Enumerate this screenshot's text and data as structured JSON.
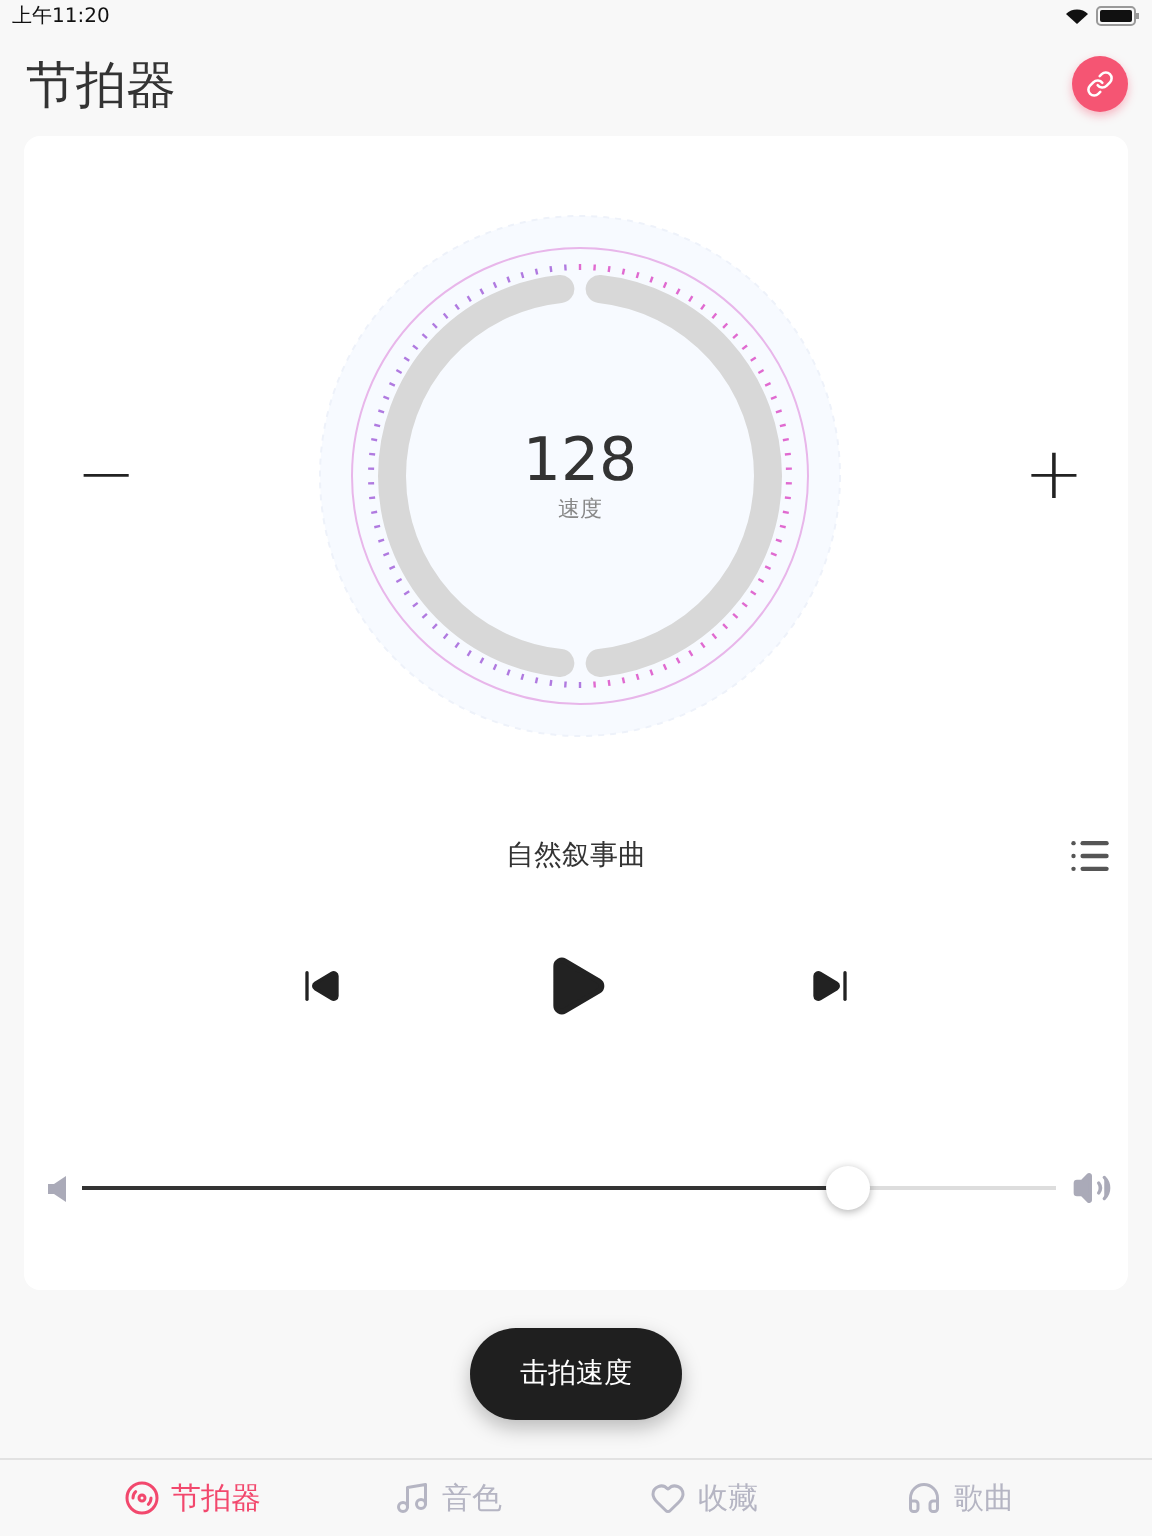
{
  "status_bar": {
    "time": "上午11:20"
  },
  "header": {
    "title": "节拍器"
  },
  "tempo": {
    "value": "128",
    "label": "速度",
    "decrease": "−",
    "increase": "+"
  },
  "song": {
    "title": "自然叙事曲"
  },
  "player": {
    "playing": false
  },
  "volume": {
    "level": 0.787
  },
  "tap_button": {
    "label": "击拍速度"
  },
  "tabs": [
    {
      "label": "节拍器",
      "selected": true
    },
    {
      "label": "音色",
      "selected": false
    },
    {
      "label": "收藏",
      "selected": false
    },
    {
      "label": "歌曲",
      "selected": false
    }
  ]
}
